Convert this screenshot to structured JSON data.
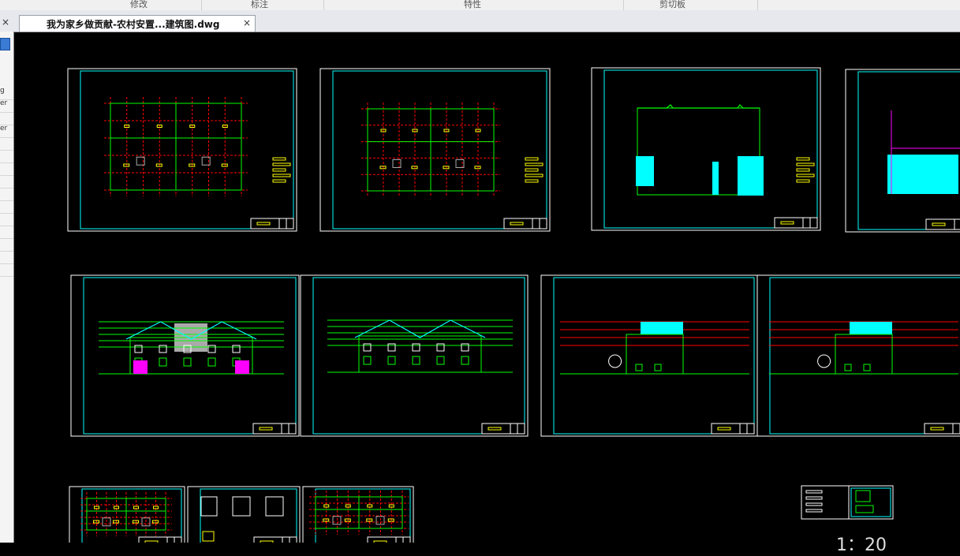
{
  "ribbon": {
    "groups": [
      "修改",
      "标注",
      "特性",
      "剪切板"
    ]
  },
  "document_tab": {
    "title": "我为家乡做贡献-农村安置...建筑图.dwg",
    "close_glyph": "×"
  },
  "left_panel": {
    "close_glyph": "×",
    "rows": [
      "g",
      "er",
      "",
      "er",
      "",
      "",
      "",
      "",
      "",
      "",
      "",
      "",
      "",
      "",
      ""
    ]
  },
  "canvas": {
    "scale_label": "1：20"
  },
  "colors": {
    "background": "#000000",
    "frame": "#ffffff",
    "inner_frame": "#00ffff",
    "wall": "#00ff00",
    "axis": "#ff0000",
    "text": "#ffff00",
    "fill_cyan": "#00ffff",
    "fill_magenta": "#ff00ff"
  }
}
